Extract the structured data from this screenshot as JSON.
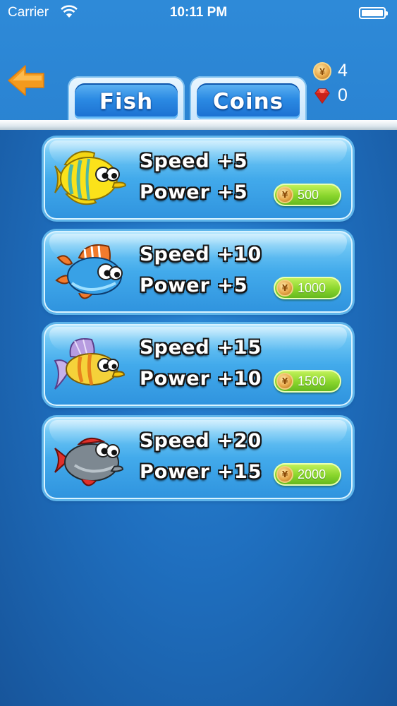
{
  "status_bar": {
    "carrier": "Carrier",
    "time": "10:11 PM"
  },
  "currency": {
    "coins": "4",
    "gems": "0",
    "coin_symbol": "¥"
  },
  "tabs": [
    {
      "label": "Fish",
      "selected": true
    },
    {
      "label": "Coins",
      "selected": false
    }
  ],
  "fish": [
    {
      "icon": "yellow-butterflyfish-icon",
      "speed_label": "Speed +5",
      "power_label": "Power +5",
      "price": "500"
    },
    {
      "icon": "orange-blue-fish-icon",
      "speed_label": "Speed +10",
      "power_label": "Power +5",
      "price": "1000"
    },
    {
      "icon": "purple-fin-striped-fish-icon",
      "speed_label": "Speed +15",
      "power_label": "Power +10",
      "price": "1500"
    },
    {
      "icon": "gray-piranha-icon",
      "speed_label": "Speed +20",
      "power_label": "Power +15",
      "price": "2000"
    }
  ],
  "colors": {
    "background": "#1f6fbf",
    "card": "#42aaeb",
    "buy_button": "#88d52c",
    "back_arrow": "#f39a1e"
  }
}
